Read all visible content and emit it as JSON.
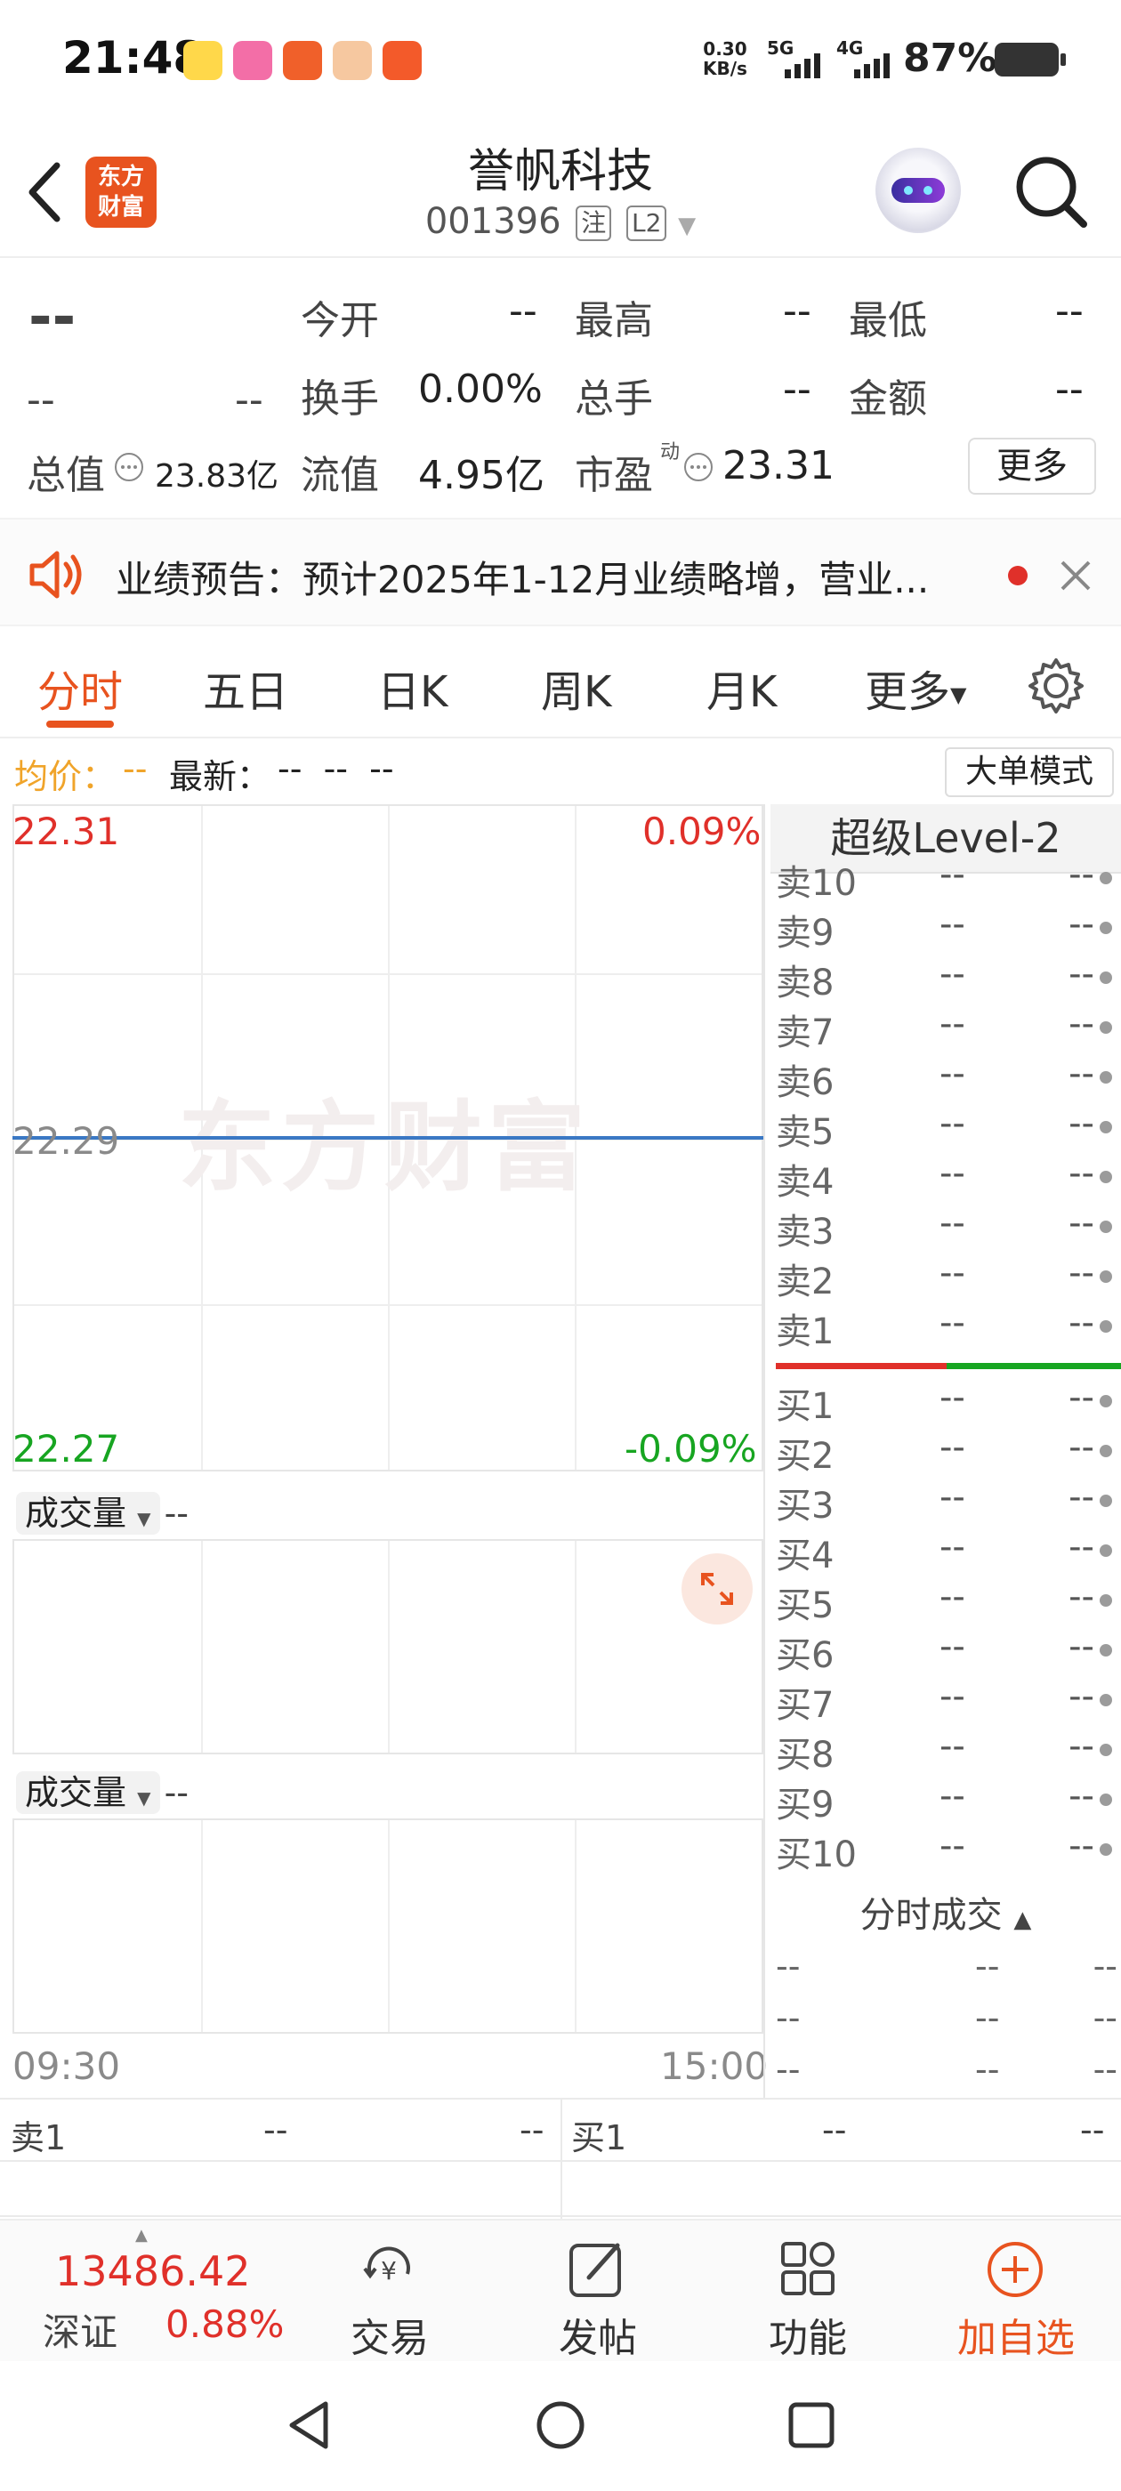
{
  "status_bar": {
    "time": "21:48",
    "net_speed_value": "0.30",
    "net_speed_unit": "KB/s",
    "signal1": "5G",
    "signal2": "4G",
    "battery": "87%"
  },
  "header": {
    "logo_line1": "东方",
    "logo_line2": "财富",
    "stock_name": "誉帆科技",
    "stock_code": "001396",
    "tag_registered": "注",
    "tag_level": "L2"
  },
  "quote": {
    "price": "--",
    "change": "--",
    "change_pct": "--",
    "open_label": "今开",
    "open_value": "--",
    "high_label": "最高",
    "high_value": "--",
    "low_label": "最低",
    "low_value": "--",
    "turnover_label": "换手",
    "turnover_value": "0.00%",
    "volume_label": "总手",
    "volume_value": "--",
    "amount_label": "金额",
    "amount_value": "--",
    "total_mv_label": "总值",
    "total_mv_value": "23.83亿",
    "float_mv_label": "流值",
    "float_mv_value": "4.95亿",
    "pe_label": "市盈",
    "pe_superscript": "动",
    "pe_value": "23.31",
    "more_label": "更多"
  },
  "notice": {
    "text": "业绩预告：预计2025年1-12月业绩略增，营业..."
  },
  "tabs": [
    {
      "label": "分时"
    },
    {
      "label": "五日"
    },
    {
      "label": "日K"
    },
    {
      "label": "周K"
    },
    {
      "label": "月K"
    },
    {
      "label": "更多"
    }
  ],
  "info_row": {
    "avg_label": "均价：",
    "avg_value": "--",
    "latest_label": "最新：",
    "latest_value": "--  --  --",
    "big_order_mode": "大单模式"
  },
  "chart": {
    "watermark": "东方财富",
    "y_top": "22.31",
    "y_mid": "22.29",
    "y_bottom": "22.27",
    "pct_top": "0.09%",
    "pct_bottom": "-0.09%",
    "volume_label_1": "成交量",
    "volume_value_1": "--",
    "volume_label_2": "成交量",
    "volume_value_2": "--",
    "time_start": "09:30",
    "time_end": "15:00"
  },
  "chart_data": {
    "type": "line",
    "x": [
      "09:30",
      "15:00"
    ],
    "series": [
      {
        "values": [
          22.29,
          22.29
        ]
      }
    ],
    "ylim": [
      22.27,
      22.31
    ],
    "ylabel_left_ticks": [
      "22.31",
      "22.29",
      "22.27"
    ],
    "ylabel_right_ticks": [
      "0.09%",
      "-0.09%"
    ],
    "grid": true
  },
  "order_book": {
    "title": "超级Level-2",
    "sell": [
      {
        "label": "卖10",
        "price": "--",
        "volume": "--"
      },
      {
        "label": "卖9",
        "price": "--",
        "volume": "--"
      },
      {
        "label": "卖8",
        "price": "--",
        "volume": "--"
      },
      {
        "label": "卖7",
        "price": "--",
        "volume": "--"
      },
      {
        "label": "卖6",
        "price": "--",
        "volume": "--"
      },
      {
        "label": "卖5",
        "price": "--",
        "volume": "--"
      },
      {
        "label": "卖4",
        "price": "--",
        "volume": "--"
      },
      {
        "label": "卖3",
        "price": "--",
        "volume": "--"
      },
      {
        "label": "卖2",
        "price": "--",
        "volume": "--"
      },
      {
        "label": "卖1",
        "price": "--",
        "volume": "--"
      }
    ],
    "buy": [
      {
        "label": "买1",
        "price": "--",
        "volume": "--"
      },
      {
        "label": "买2",
        "price": "--",
        "volume": "--"
      },
      {
        "label": "买3",
        "price": "--",
        "volume": "--"
      },
      {
        "label": "买4",
        "price": "--",
        "volume": "--"
      },
      {
        "label": "买5",
        "price": "--",
        "volume": "--"
      },
      {
        "label": "买6",
        "price": "--",
        "volume": "--"
      },
      {
        "label": "买7",
        "price": "--",
        "volume": "--"
      },
      {
        "label": "买8",
        "price": "--",
        "volume": "--"
      },
      {
        "label": "买9",
        "price": "--",
        "volume": "--"
      },
      {
        "label": "买10",
        "price": "--",
        "volume": "--"
      }
    ],
    "ticks_title": "分时成交",
    "ticks": [
      {
        "time": "--",
        "price": "--",
        "volume": "--"
      },
      {
        "time": "--",
        "price": "--",
        "volume": "--"
      },
      {
        "time": "--",
        "price": "--",
        "volume": "--"
      }
    ]
  },
  "bottom_quote": {
    "sell1_label": "卖1",
    "sell1_price": "--",
    "sell1_volume": "--",
    "buy1_label": "买1",
    "buy1_price": "--",
    "buy1_volume": "--"
  },
  "bottom_nav": {
    "index_value": "13486.42",
    "index_name": "深证",
    "index_change": "0.88%",
    "trade": "交易",
    "post": "发帖",
    "functions": "功能",
    "add_watch": "加自选"
  },
  "colors": {
    "accent": "#e8531f",
    "up": "#e0302a",
    "down": "#17a521",
    "avg_price": "#f0a42a",
    "price_line": "#3a78c4"
  }
}
